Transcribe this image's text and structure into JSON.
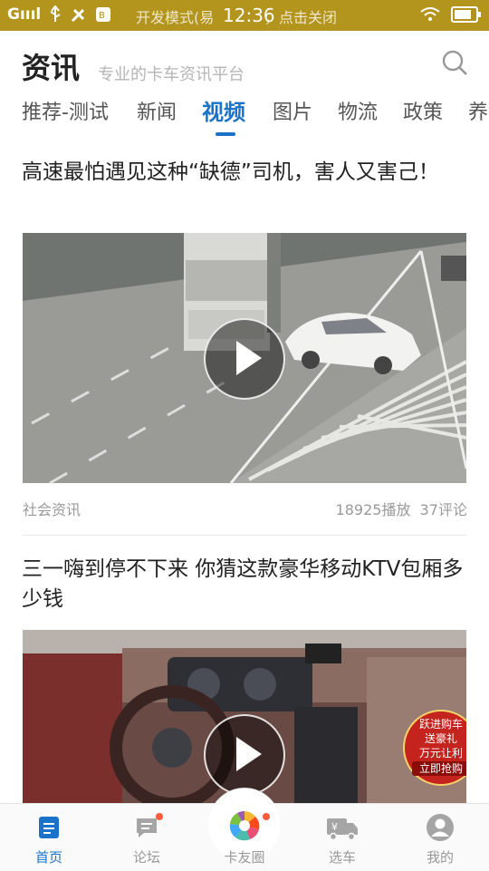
{
  "status_bar": {
    "signal_label": "Gıııl",
    "dev_mode_text": "开发模式(易",
    "time": "12:36",
    "close_hint": "，点击关闭",
    "battery_level": 0.8
  },
  "header": {
    "title": "资讯",
    "subtitle": "专业的卡车资讯平台",
    "search_icon": "search-icon"
  },
  "tabs": [
    {
      "label": "推荐-测试",
      "active": false
    },
    {
      "label": "新闻",
      "active": false
    },
    {
      "label": "视频",
      "active": true
    },
    {
      "label": "图片",
      "active": false
    },
    {
      "label": "物流",
      "active": false
    },
    {
      "label": "政策",
      "active": false
    },
    {
      "label": "养",
      "active": false
    }
  ],
  "articles": [
    {
      "title": "高速最怕遇见这种“缺德”司机，害人又害己！",
      "category": "社会资讯",
      "plays": "18925播放",
      "comments": "37评论"
    },
    {
      "title": "三一嗨到停不下来 你猜这款豪华移动KTV包厢多少钱",
      "promo": {
        "line1": "跃进购车",
        "line2": "送豪礼",
        "line3": "万元让利",
        "button": "立即抢购"
      }
    }
  ],
  "bottom_nav": [
    {
      "label": "首页",
      "icon": "home-doc-icon",
      "active": true
    },
    {
      "label": "论坛",
      "icon": "forum-chat-icon",
      "active": false,
      "badge": true
    },
    {
      "label": "卡友圈",
      "icon": "pinwheel-icon",
      "active": false,
      "badge": true
    },
    {
      "label": "选车",
      "icon": "truck-price-icon",
      "active": false
    },
    {
      "label": "我的",
      "icon": "profile-icon",
      "active": false
    }
  ],
  "colors": {
    "status_bar": "#b3941c",
    "accent": "#1a73c9",
    "badge": "#ff5a3a"
  }
}
